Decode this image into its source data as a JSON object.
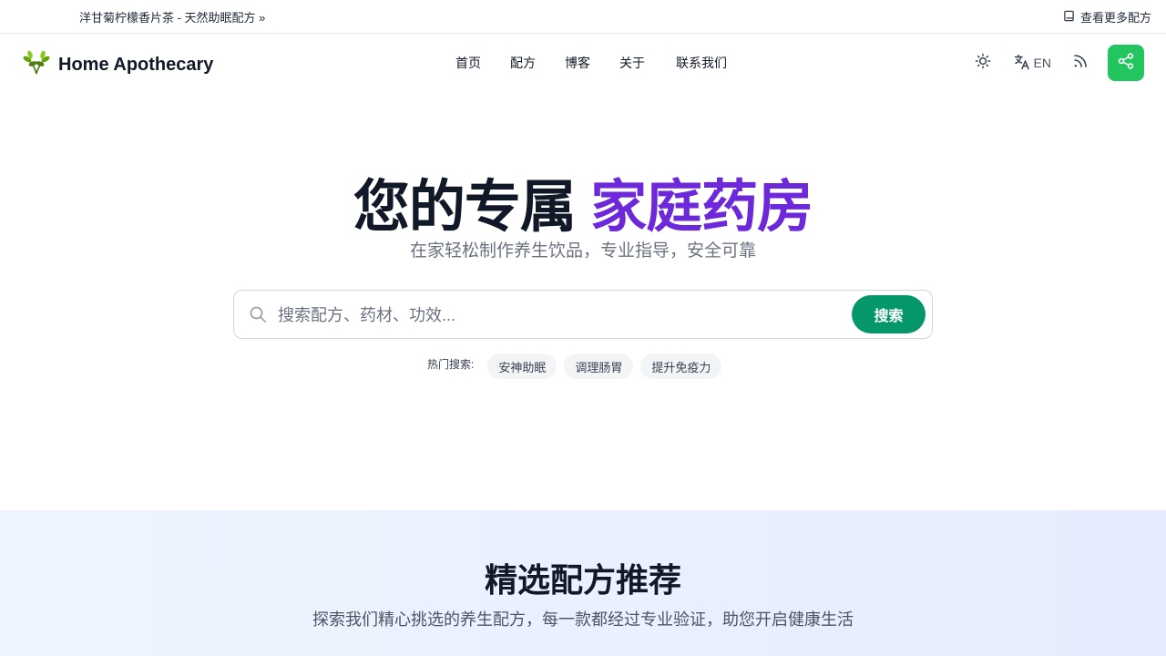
{
  "announcement": {
    "link_text": "洋甘菊柠檬香片茶 - 天然助眠配方 »",
    "more_text": "查看更多配方"
  },
  "header": {
    "brand_name": "Home Apothecary",
    "nav": [
      "首页",
      "配方",
      "博客",
      "关于",
      "联系我们"
    ],
    "lang_label": "EN",
    "accent_color": "#22c55e"
  },
  "hero": {
    "title_main": "您的专属 ",
    "title_accent": "家庭药房",
    "subtitle": "在家轻松制作养生饮品，专业指导，安全可靠",
    "accent_color": "#6d28d9"
  },
  "search": {
    "placeholder": "搜索配方、药材、功效...",
    "button_label": "搜索",
    "button_color": "#059669",
    "hot_label": "热门搜索:",
    "hot_tags": [
      "安神助眠",
      "调理肠胃",
      "提升免疫力"
    ]
  },
  "featured": {
    "title": "精选配方推荐",
    "subtitle": "探索我们精心挑选的养生配方，每一款都经过专业验证，助您开启健康生活"
  }
}
